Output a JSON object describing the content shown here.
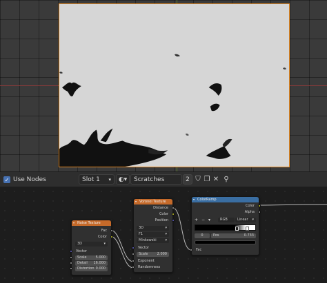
{
  "header": {
    "use_nodes_label": "Use Nodes",
    "use_nodes_checked": "✓",
    "slot_label": "Slot 1",
    "material_name": "Scratches",
    "user_count": "2",
    "icons": [
      "checkbox-icon",
      "chevron-down-icon",
      "material-sphere-icon",
      "fake-user-shield-icon",
      "duplicate-icon",
      "unlink-icon",
      "pin-icon"
    ]
  },
  "nodes": {
    "noise": {
      "title": "Noise Texture",
      "out_fac": "Fac",
      "out_color": "Color",
      "dimensions": "3D",
      "in_vector": "Vector",
      "scale_label": "Scale",
      "scale_value": "5.000",
      "detail_label": "Detail",
      "detail_value": "16.000",
      "distortion_label": "Distortion",
      "distortion_value": "0.000"
    },
    "voronoi": {
      "title": "Voronoi Texture",
      "out_distance": "Distance",
      "out_color": "Color",
      "out_position": "Position",
      "dimensions": "3D",
      "feature": "F1",
      "metric": "Minkowski",
      "in_vector": "Vector",
      "scale_label": "Scale",
      "scale_value": "2.000",
      "in_exponent": "Exponent",
      "in_randomness": "Randomness"
    },
    "colorramp": {
      "title": "ColorRamp",
      "out_color": "Color",
      "out_alpha": "Alpha",
      "color_mode": "RGB",
      "interpolation": "Linear",
      "stop_index": "0",
      "pos_label": "Pos",
      "pos_value": "0.733",
      "in_fac": "Fac"
    }
  },
  "colors": {
    "texture_header": "#c56a2a",
    "converter_header": "#3a6ea2",
    "active_border": "#e58a24",
    "accent_blue": "#4772b3"
  }
}
